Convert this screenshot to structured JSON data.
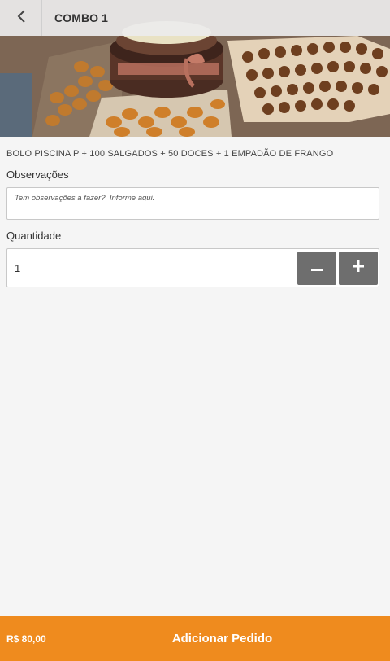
{
  "header": {
    "title": "COMBO 1",
    "back_icon": "chevron-left-icon"
  },
  "product": {
    "description": "BOLO PISCINA P + 100 SALGADOS + 50 DOCES + 1 EMPADÃO DE FRANGO",
    "image": "food-platter-photo"
  },
  "observations": {
    "label": "Observações",
    "placeholder": "Tem observações a fazer?  Informe aqui.",
    "value": ""
  },
  "quantity": {
    "label": "Quantidade",
    "value": "1",
    "minus_icon": "minus-icon",
    "plus_icon": "plus-icon"
  },
  "footer": {
    "price": "R$ 80,00",
    "add_label": "Adicionar Pedido"
  },
  "colors": {
    "accent": "#ef8b1e",
    "stepper": "#6e6e6e",
    "background": "#f5f5f5"
  }
}
